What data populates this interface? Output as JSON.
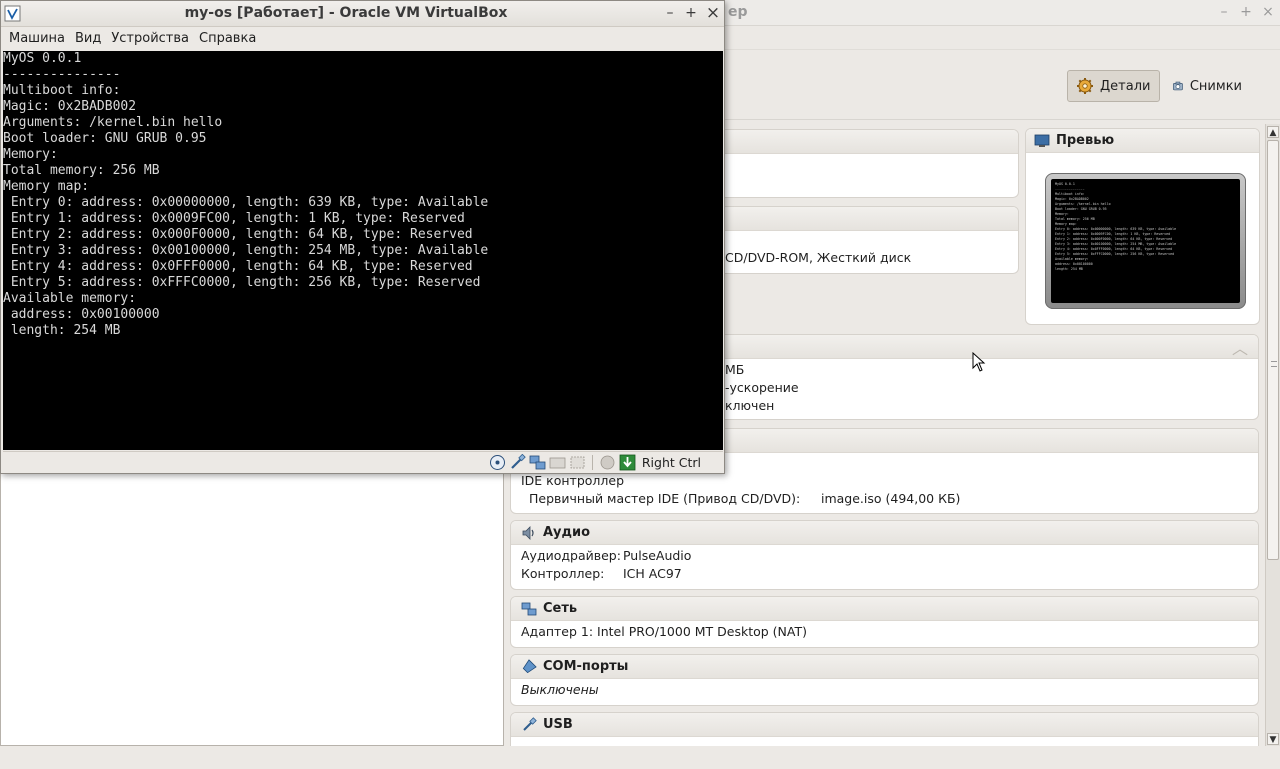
{
  "manager": {
    "title_tail": "ер",
    "toolbar": {
      "details_label": "Детали",
      "snapshots_label": "Снимки"
    },
    "preview_title": "Превью",
    "sections": {
      "general_fragment": "",
      "system_fragment": "CD/DVD-ROM, Жесткий диск",
      "display_fragments": [
        "МБ",
        "-ускорение",
        "ключен"
      ],
      "storage": {
        "controller": "IDE контроллер",
        "device_key": "Первичный мастер IDE (Привод CD/DVD):",
        "device_val": "image.iso (494,00 КБ)"
      },
      "audio": {
        "title": "Аудио",
        "driver_key": "Аудиодрайвер:",
        "driver_val": "PulseAudio",
        "controller_key": "Контроллер:",
        "controller_val": "ICH AC97"
      },
      "network": {
        "title": "Сеть",
        "adapter": "Адаптер 1: Intel PRO/1000 MT Desktop (NAT)"
      },
      "serial": {
        "title": "COM-порты",
        "value": "Выключены"
      },
      "usb": {
        "title": "USB"
      }
    }
  },
  "vm": {
    "title": "my-os [Работает] - Oracle VM VirtualBox",
    "menu": [
      "Машина",
      "Вид",
      "Устройства",
      "Справка"
    ],
    "console_lines": [
      "MyOS 0.0.1",
      "---------------",
      "Multiboot info:",
      "Magic: 0x2BADB002",
      "Arguments: /kernel.bin hello",
      "Boot loader: GNU GRUB 0.95",
      "Memory:",
      "Total memory: 256 MB",
      "Memory map:",
      " Entry 0: address: 0x00000000, length: 639 KB, type: Available",
      " Entry 1: address: 0x0009FC00, length: 1 KB, type: Reserved",
      " Entry 2: address: 0x000F0000, length: 64 KB, type: Reserved",
      " Entry 3: address: 0x00100000, length: 254 MB, type: Available",
      " Entry 4: address: 0x0FFF0000, length: 64 KB, type: Reserved",
      " Entry 5: address: 0xFFFC0000, length: 256 KB, type: Reserved",
      "Available memory:",
      " address: 0x00100000",
      " length: 254 MB"
    ],
    "status_hostkey": "Right Ctrl"
  },
  "icons": {
    "minimize": "–",
    "maximize": "+",
    "close": "×",
    "scroll_up": "▲",
    "scroll_down": "▼",
    "collapse": "⌃"
  }
}
